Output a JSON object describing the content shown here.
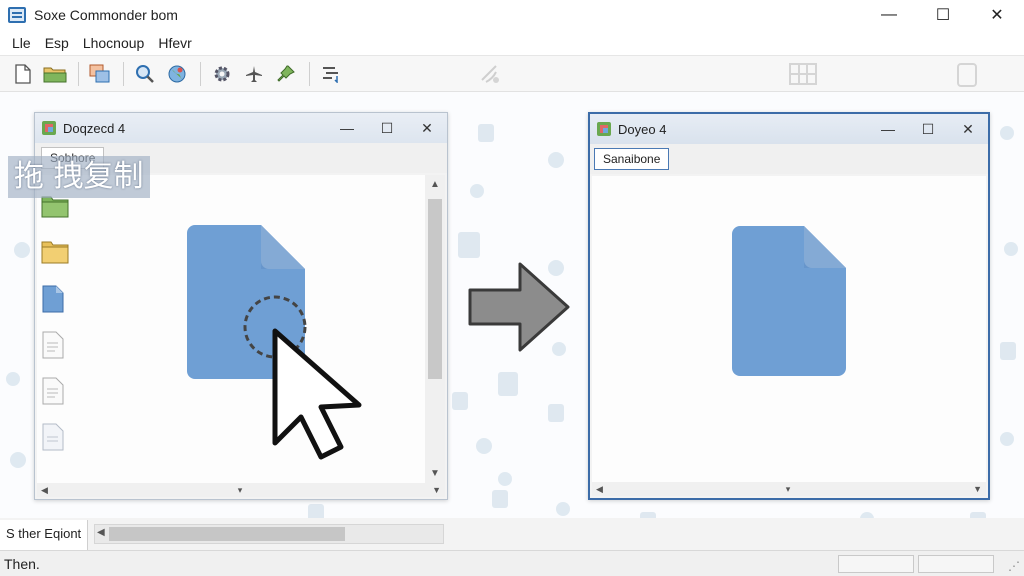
{
  "app": {
    "title": "Soxe Commonder bom",
    "window_controls": {
      "minimize": "—",
      "maximize": "☐",
      "close": "✕"
    }
  },
  "menu": [
    "Lle",
    "Esp",
    "Lhocnoup",
    "Hfevr"
  ],
  "toolbar": {
    "icons": [
      "new-file-icon",
      "open-folder-icon",
      "copy-windows-icon",
      "search-icon",
      "globe-icon",
      "settings-gear-icon",
      "airplane-icon",
      "pin-icon",
      "sort-list-icon"
    ]
  },
  "overlay_label": "拖 拽复制",
  "left_panel": {
    "title": "Doqzecd 4",
    "tab": "Sobhore",
    "controls": {
      "minimize": "—",
      "maximize": "☐",
      "close": "✕"
    },
    "scroll_up": "▲",
    "scroll_down": "▼",
    "h_left": "◀",
    "h_mid": "▾",
    "h_right": "▼"
  },
  "right_panel": {
    "title": "Doyeo 4",
    "tab": "Sanaibone",
    "controls": {
      "minimize": "—",
      "maximize": "☐",
      "close": "✕"
    },
    "h_left": "◀",
    "h_mid": "▾",
    "h_right": "▼"
  },
  "bottom_tab": "S ther Eqiont",
  "bottom_scroll_left": "◀",
  "status": "Then.",
  "colors": {
    "doc_blue": "#6f9fd4",
    "doc_fold": "#a9c6e6",
    "accent": "#3c6ca8"
  }
}
